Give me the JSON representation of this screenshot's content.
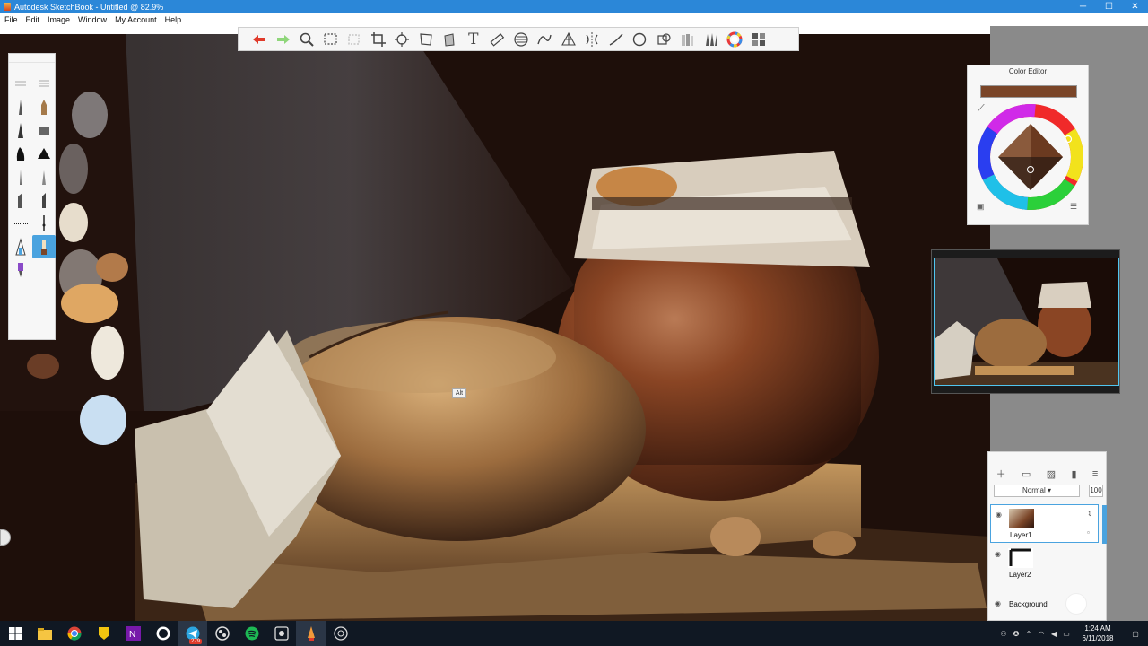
{
  "window": {
    "title": "Autodesk SketchBook - Untitled @ 82.9%",
    "controls": {
      "minimize": "─",
      "maximize": "☐",
      "close": "✕"
    }
  },
  "menu": [
    "File",
    "Edit",
    "Image",
    "Window",
    "My Account",
    "Help"
  ],
  "toolbar": {
    "tools": [
      "undo-icon",
      "redo-icon",
      "zoom-icon",
      "select-icon",
      "crop-select-icon",
      "crop-icon",
      "transform-icon",
      "distort-icon",
      "fill-icon",
      "text-icon",
      "ruler-icon",
      "ellipse-guide-icon",
      "french-curve-icon",
      "perspective-icon",
      "symmetry-icon",
      "line-icon",
      "circle-icon",
      "stroke-icon",
      "copic-icon",
      "brush-library-icon",
      "color-wheel-icon",
      "palette-icon"
    ],
    "text_label": "T"
  },
  "color_editor": {
    "title": "Color Editor",
    "current_color": "#7a4528"
  },
  "canvas": {
    "tooltip": "Alt"
  },
  "layers": {
    "blend_mode": "Normal",
    "opacity": "100",
    "items": [
      {
        "name": "Layer1",
        "selected": true
      },
      {
        "name": "Layer2",
        "selected": false
      },
      {
        "name": "Background",
        "selected": false
      }
    ]
  },
  "taskbar": {
    "badge": "279",
    "clock_time": "1:24 AM",
    "clock_date": "6/11/2018"
  },
  "colors": {
    "titlebar": "#2b87d8",
    "accent": "#4aa3df",
    "taskbar": "#101823",
    "canvas_bg": "#1e0f0a"
  }
}
